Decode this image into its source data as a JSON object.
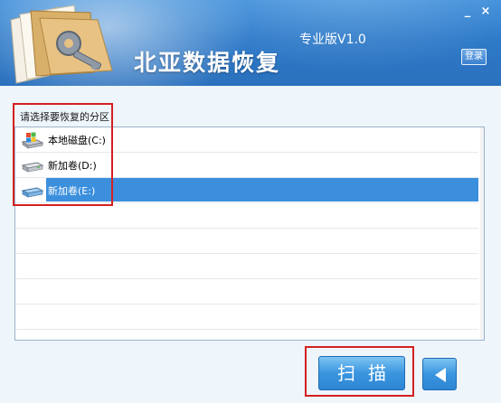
{
  "window": {
    "app_title": "北亚数据恢复",
    "edition": "专业版V1.0",
    "minimize_label": "_",
    "close_label": "×",
    "login_label": "登录"
  },
  "partition_panel": {
    "prompt": "请选择要恢复的分区",
    "partitions": [
      {
        "label": "本地磁盘(C:)",
        "icon": "system-drive-icon",
        "selected": false
      },
      {
        "label": "新加卷(D:)",
        "icon": "hard-drive-icon",
        "selected": false
      },
      {
        "label": "新加卷(E:)",
        "icon": "hard-drive-icon",
        "selected": true
      }
    ]
  },
  "actions": {
    "scan_label": "扫描",
    "back_icon": "back-arrow-icon"
  },
  "colors": {
    "header": "#2f7bc9",
    "selection": "#3b8fdd",
    "highlight": "#d42020"
  }
}
